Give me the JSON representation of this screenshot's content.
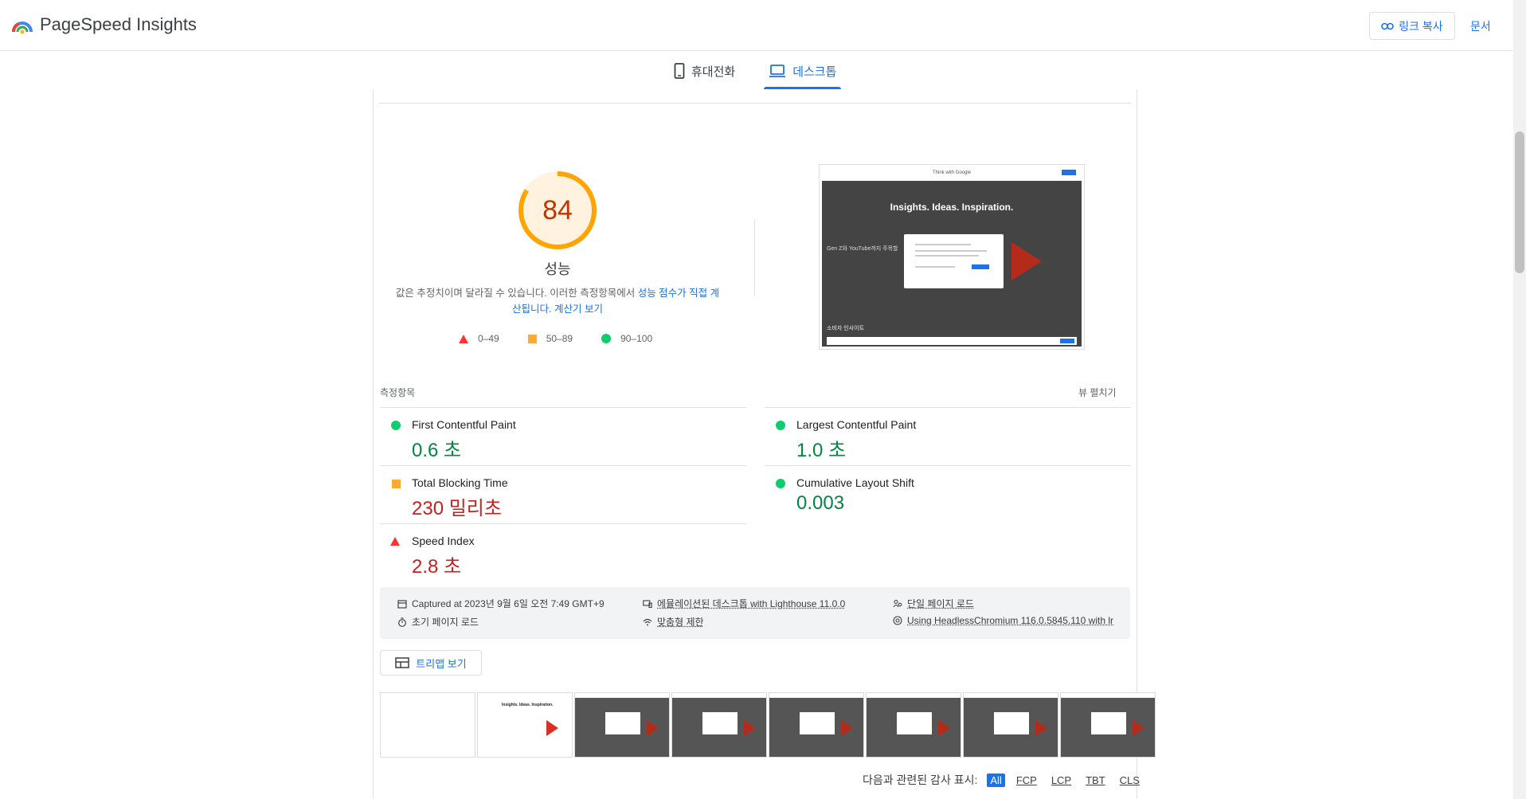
{
  "header": {
    "app_name": "PageSpeed Insights",
    "copy_link_label": "링크 복사",
    "docs_label": "문서"
  },
  "tabs": [
    {
      "label": "휴대전화",
      "active": false
    },
    {
      "label": "데스크톱",
      "active": true
    }
  ],
  "score": {
    "value": "84",
    "fraction": 0.84,
    "label": "성능",
    "desc_prefix": "값은 추정치이며 달라질 수 있습니다. 이러한 측정항목에서 ",
    "desc_link1": "성능 점수가 직접 계산됩니다.",
    "desc_link2": "계산기 보기",
    "color": "#ffa400"
  },
  "legend": {
    "bad": "0–49",
    "average": "50–89",
    "good": "90–100"
  },
  "screenshot": {
    "brand": "Think with Google",
    "headline": "Insights. Ideas. Inspiration.",
    "sub1": "Gen Z와 YouTube까지 주목할",
    "sub2": "소비자 인사이트"
  },
  "metrics_section": {
    "title": "측정항목",
    "expand_label": "뷰 펼치기"
  },
  "metrics": [
    {
      "name": "First Contentful Paint",
      "value": "0.6 초",
      "rating": "good"
    },
    {
      "name": "Largest Contentful Paint",
      "value": "1.0 초",
      "rating": "good"
    },
    {
      "name": "Total Blocking Time",
      "value": "230 밀리초",
      "rating": "average"
    },
    {
      "name": "Cumulative Layout Shift",
      "value": "0.003",
      "rating": "good"
    },
    {
      "name": "Speed Index",
      "value": "2.8 초",
      "rating": "bad"
    }
  ],
  "info": {
    "captured": "Captured at 2023년 9월 6일 오전 7:49 GMT+9",
    "initial_load": "초기 페이지 로드",
    "emulated": "에뮬레이션된 데스크톱 with Lighthouse 11.0.0",
    "throttling": "맞춤형 제한",
    "single_load": "단일 페이지 로드",
    "browser": "Using HeadlessChromium 116.0.5845.110 with lr"
  },
  "treemap_label": "트리맵 보기",
  "audit_filter": {
    "label": "다음과 관련된 감사 표시:",
    "chips": [
      "All",
      "FCP",
      "LCP",
      "TBT",
      "CLS"
    ]
  },
  "colors": {
    "accent": "#1a73e8",
    "good": "#0cce6b",
    "average": "#ffaa33",
    "bad": "#ff3333"
  }
}
